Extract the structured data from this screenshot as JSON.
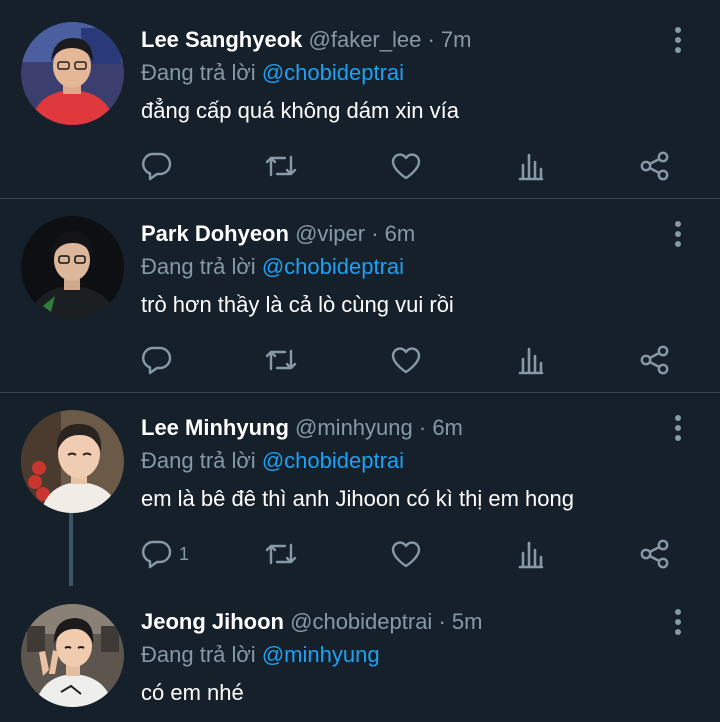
{
  "tweets": [
    {
      "name": "Lee Sanghyeok",
      "handle": "@faker_lee",
      "time": "· 7m",
      "reply_prefix": "Đang trả lời",
      "reply_to": "@chobideptrai",
      "text": "đẳng cấp quá không dám xin vía",
      "reply_count": ""
    },
    {
      "name": "Park Dohyeon",
      "handle": "@viper",
      "time": "· 6m",
      "reply_prefix": "Đang trả lời",
      "reply_to": "@chobideptrai",
      "text": "trò hơn thầy là cả lò cùng vui rồi",
      "reply_count": ""
    },
    {
      "name": "Lee Minhyung",
      "handle": "@minhyung",
      "time": "· 6m",
      "reply_prefix": "Đang trả lời",
      "reply_to": "@chobideptrai",
      "text": "em là bê đê thì anh Jihoon có kì thị em hong",
      "reply_count": "1"
    },
    {
      "name": "Jeong Jihoon",
      "handle": "@chobideptrai",
      "time": "· 5m",
      "reply_prefix": "Đang trả lời",
      "reply_to": "@minhyung",
      "text": "có em nhé",
      "reply_count": ""
    }
  ],
  "icons": {
    "reply": "reply-icon",
    "retweet": "retweet-icon",
    "like": "heart-icon",
    "stats": "stats-icon",
    "share": "share-icon",
    "more": "more-icon"
  },
  "colors": {
    "background": "#15202b",
    "text": "#ffffff",
    "muted": "#8899a6",
    "link": "#1da1f2",
    "divider": "#38444d"
  }
}
